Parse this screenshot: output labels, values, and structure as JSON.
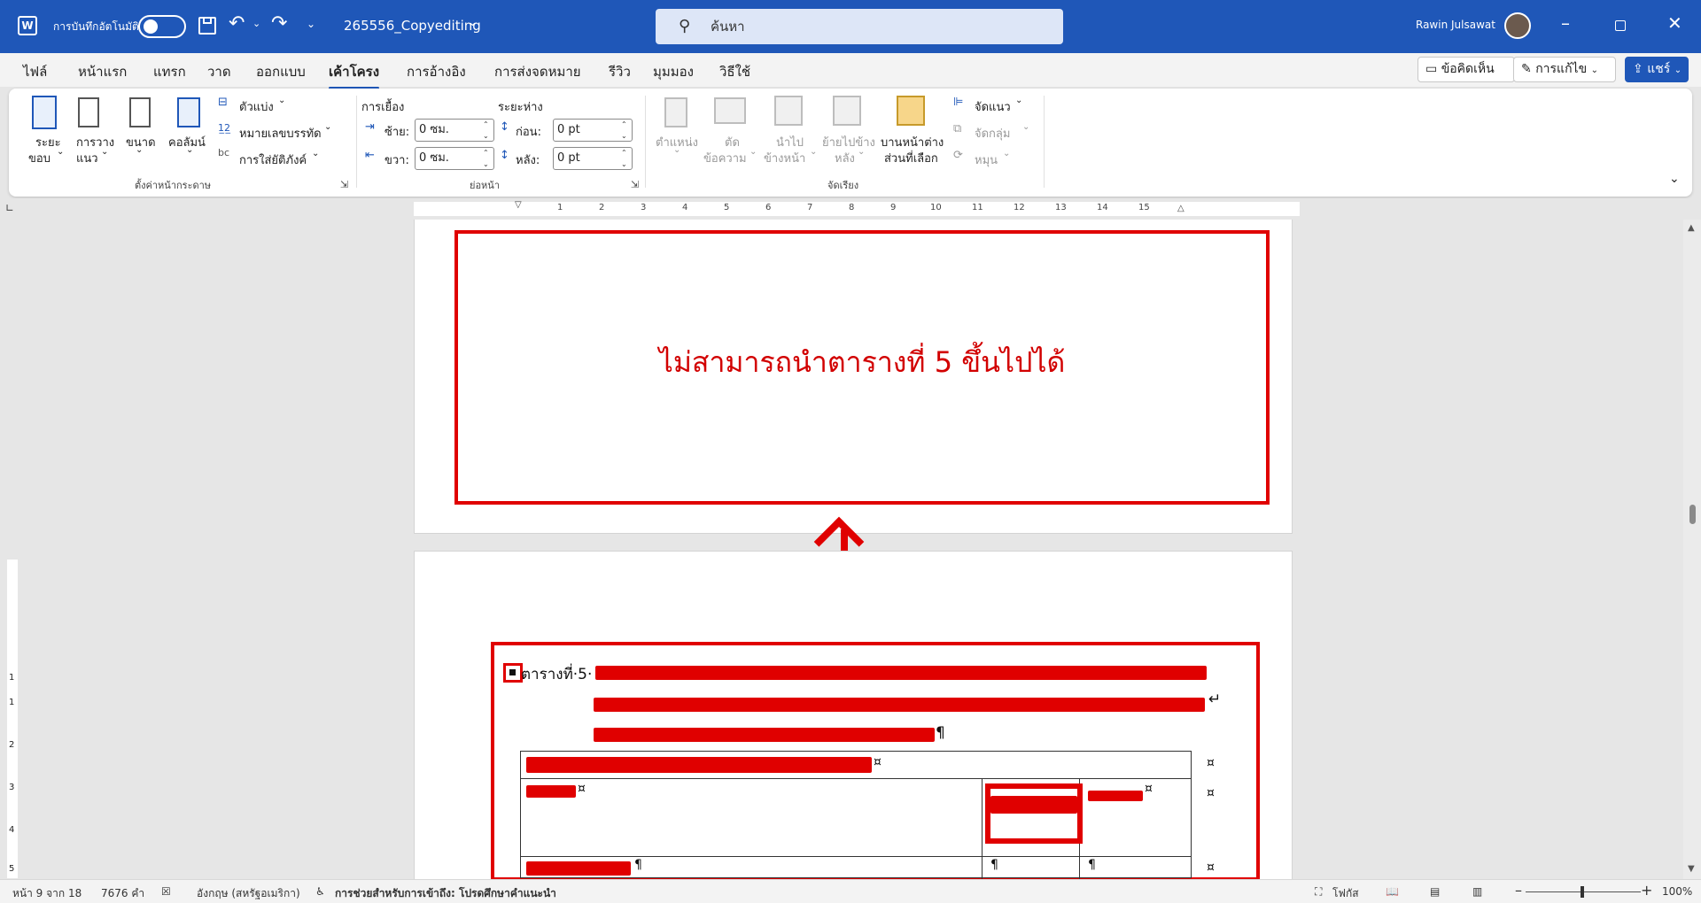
{
  "titlebar": {
    "autosave_label": "การบันทึกอัตโนมัติ",
    "doc_title": "265556_Copyediting",
    "search_placeholder": "ค้นหา",
    "user_name": "Rawin Julsawat",
    "brand_color": "#1f57b8"
  },
  "menu": {
    "tabs": [
      "ไฟล์",
      "หน้าแรก",
      "แทรก",
      "วาด",
      "ออกแบบ",
      "เค้าโครง",
      "การอ้างอิง",
      "การส่งจดหมาย",
      "รีวิว",
      "มุมมอง",
      "วิธีใช้"
    ],
    "active_tab": "เค้าโครง",
    "comments": "ข้อคิดเห็น",
    "editing": "การแก้ไข",
    "share": "แชร์"
  },
  "ribbon": {
    "page_setup": {
      "margins": [
        "ระยะ",
        "ขอบ"
      ],
      "orientation": [
        "การวาง",
        "แนว"
      ],
      "size": "ขนาด",
      "columns": "คอลัมน์",
      "breaks": "ตัวแบ่ง",
      "line_numbers": "หมายเลขบรรทัด",
      "hyphenation": "การใส่ยัติภังค์",
      "group_label": "ตั้งค่าหน้ากระดาษ"
    },
    "paragraph": {
      "indent_label": "การเยื้อง",
      "spacing_label": "ระยะห่าง",
      "left_label": "ซ้าย:",
      "right_label": "ขวา:",
      "before_label": "ก่อน:",
      "after_label": "หลัง:",
      "left_value": "0 ซม.",
      "right_value": "0 ซม.",
      "before_value": "0 pt",
      "after_value": "0 pt",
      "group_label": "ย่อหน้า"
    },
    "arrange": {
      "position": "ตำแหน่ง",
      "wrap": [
        "ตัด",
        "ข้อความ"
      ],
      "forward": [
        "นำไป",
        "ข้างหน้า"
      ],
      "backward": [
        "ย้ายไปข้าง",
        "หลัง"
      ],
      "selection_pane": [
        "บานหน้าต่าง",
        "ส่วนที่เลือก"
      ],
      "align": "จัดแนว",
      "group": "จัดกลุ่ม",
      "rotate": "หมุน",
      "group_label": "จัดเรียง"
    }
  },
  "ruler_ticks": [
    "1",
    "2",
    "3",
    "4",
    "5",
    "6",
    "7",
    "8",
    "9",
    "10",
    "11",
    "12",
    "13",
    "14",
    "15"
  ],
  "vruler_ticks": [
    "1",
    "1",
    "2",
    "3",
    "4",
    "5"
  ],
  "document": {
    "annotation_text": "ไม่สามารถนำตารางที่ 5 ขึ้นไปได้",
    "caption_start": "ตารางที่·5·",
    "pilcrow": "¶",
    "cell_mark": "¤",
    "accent_red": "#e00000"
  },
  "status": {
    "page": "หน้า 9 จาก 18",
    "words": "7676 คำ",
    "language": "อังกฤษ (สหรัฐอเมริกา)",
    "accessibility": "การช่วยสำหรับการเข้าถึง: โปรดศึกษาคำแนะนำ",
    "focus": "โฟกัส",
    "zoom": "100%"
  }
}
